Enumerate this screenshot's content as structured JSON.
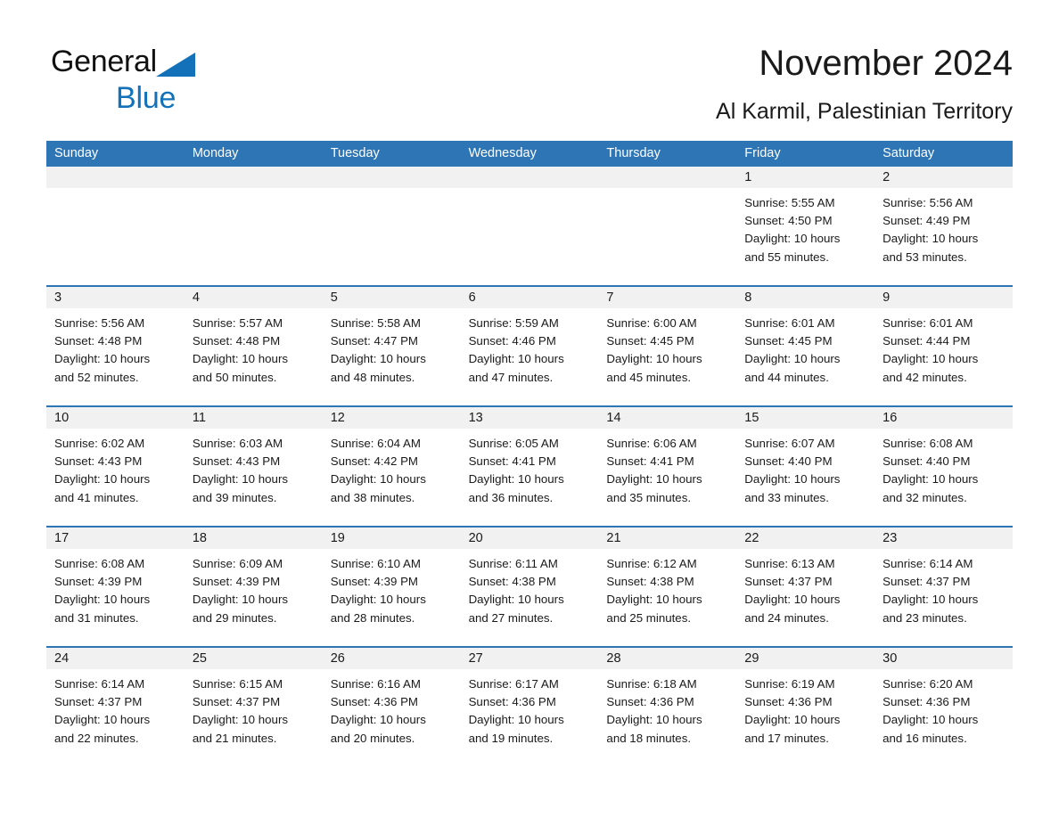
{
  "brand": {
    "word1": "General",
    "word2": "Blue",
    "accent_color": "#1271b8",
    "triangle_icon": "brand-triangle-icon"
  },
  "header": {
    "title": "November 2024",
    "subtitle": "Al Karmil, Palestinian Territory"
  },
  "theme": {
    "header_blue": "#2e75b6",
    "day_band_gray": "#f1f1f1",
    "text_color": "#1a1a1a"
  },
  "weekdays": [
    "Sunday",
    "Monday",
    "Tuesday",
    "Wednesday",
    "Thursday",
    "Friday",
    "Saturday"
  ],
  "weeks": [
    [
      {
        "empty": true
      },
      {
        "empty": true
      },
      {
        "empty": true
      },
      {
        "empty": true
      },
      {
        "empty": true
      },
      {
        "day": "1",
        "sunrise": "Sunrise: 5:55 AM",
        "sunset": "Sunset: 4:50 PM",
        "daylight1": "Daylight: 10 hours",
        "daylight2": "and 55 minutes."
      },
      {
        "day": "2",
        "sunrise": "Sunrise: 5:56 AM",
        "sunset": "Sunset: 4:49 PM",
        "daylight1": "Daylight: 10 hours",
        "daylight2": "and 53 minutes."
      }
    ],
    [
      {
        "day": "3",
        "sunrise": "Sunrise: 5:56 AM",
        "sunset": "Sunset: 4:48 PM",
        "daylight1": "Daylight: 10 hours",
        "daylight2": "and 52 minutes."
      },
      {
        "day": "4",
        "sunrise": "Sunrise: 5:57 AM",
        "sunset": "Sunset: 4:48 PM",
        "daylight1": "Daylight: 10 hours",
        "daylight2": "and 50 minutes."
      },
      {
        "day": "5",
        "sunrise": "Sunrise: 5:58 AM",
        "sunset": "Sunset: 4:47 PM",
        "daylight1": "Daylight: 10 hours",
        "daylight2": "and 48 minutes."
      },
      {
        "day": "6",
        "sunrise": "Sunrise: 5:59 AM",
        "sunset": "Sunset: 4:46 PM",
        "daylight1": "Daylight: 10 hours",
        "daylight2": "and 47 minutes."
      },
      {
        "day": "7",
        "sunrise": "Sunrise: 6:00 AM",
        "sunset": "Sunset: 4:45 PM",
        "daylight1": "Daylight: 10 hours",
        "daylight2": "and 45 minutes."
      },
      {
        "day": "8",
        "sunrise": "Sunrise: 6:01 AM",
        "sunset": "Sunset: 4:45 PM",
        "daylight1": "Daylight: 10 hours",
        "daylight2": "and 44 minutes."
      },
      {
        "day": "9",
        "sunrise": "Sunrise: 6:01 AM",
        "sunset": "Sunset: 4:44 PM",
        "daylight1": "Daylight: 10 hours",
        "daylight2": "and 42 minutes."
      }
    ],
    [
      {
        "day": "10",
        "sunrise": "Sunrise: 6:02 AM",
        "sunset": "Sunset: 4:43 PM",
        "daylight1": "Daylight: 10 hours",
        "daylight2": "and 41 minutes."
      },
      {
        "day": "11",
        "sunrise": "Sunrise: 6:03 AM",
        "sunset": "Sunset: 4:43 PM",
        "daylight1": "Daylight: 10 hours",
        "daylight2": "and 39 minutes."
      },
      {
        "day": "12",
        "sunrise": "Sunrise: 6:04 AM",
        "sunset": "Sunset: 4:42 PM",
        "daylight1": "Daylight: 10 hours",
        "daylight2": "and 38 minutes."
      },
      {
        "day": "13",
        "sunrise": "Sunrise: 6:05 AM",
        "sunset": "Sunset: 4:41 PM",
        "daylight1": "Daylight: 10 hours",
        "daylight2": "and 36 minutes."
      },
      {
        "day": "14",
        "sunrise": "Sunrise: 6:06 AM",
        "sunset": "Sunset: 4:41 PM",
        "daylight1": "Daylight: 10 hours",
        "daylight2": "and 35 minutes."
      },
      {
        "day": "15",
        "sunrise": "Sunrise: 6:07 AM",
        "sunset": "Sunset: 4:40 PM",
        "daylight1": "Daylight: 10 hours",
        "daylight2": "and 33 minutes."
      },
      {
        "day": "16",
        "sunrise": "Sunrise: 6:08 AM",
        "sunset": "Sunset: 4:40 PM",
        "daylight1": "Daylight: 10 hours",
        "daylight2": "and 32 minutes."
      }
    ],
    [
      {
        "day": "17",
        "sunrise": "Sunrise: 6:08 AM",
        "sunset": "Sunset: 4:39 PM",
        "daylight1": "Daylight: 10 hours",
        "daylight2": "and 31 minutes."
      },
      {
        "day": "18",
        "sunrise": "Sunrise: 6:09 AM",
        "sunset": "Sunset: 4:39 PM",
        "daylight1": "Daylight: 10 hours",
        "daylight2": "and 29 minutes."
      },
      {
        "day": "19",
        "sunrise": "Sunrise: 6:10 AM",
        "sunset": "Sunset: 4:39 PM",
        "daylight1": "Daylight: 10 hours",
        "daylight2": "and 28 minutes."
      },
      {
        "day": "20",
        "sunrise": "Sunrise: 6:11 AM",
        "sunset": "Sunset: 4:38 PM",
        "daylight1": "Daylight: 10 hours",
        "daylight2": "and 27 minutes."
      },
      {
        "day": "21",
        "sunrise": "Sunrise: 6:12 AM",
        "sunset": "Sunset: 4:38 PM",
        "daylight1": "Daylight: 10 hours",
        "daylight2": "and 25 minutes."
      },
      {
        "day": "22",
        "sunrise": "Sunrise: 6:13 AM",
        "sunset": "Sunset: 4:37 PM",
        "daylight1": "Daylight: 10 hours",
        "daylight2": "and 24 minutes."
      },
      {
        "day": "23",
        "sunrise": "Sunrise: 6:14 AM",
        "sunset": "Sunset: 4:37 PM",
        "daylight1": "Daylight: 10 hours",
        "daylight2": "and 23 minutes."
      }
    ],
    [
      {
        "day": "24",
        "sunrise": "Sunrise: 6:14 AM",
        "sunset": "Sunset: 4:37 PM",
        "daylight1": "Daylight: 10 hours",
        "daylight2": "and 22 minutes."
      },
      {
        "day": "25",
        "sunrise": "Sunrise: 6:15 AM",
        "sunset": "Sunset: 4:37 PM",
        "daylight1": "Daylight: 10 hours",
        "daylight2": "and 21 minutes."
      },
      {
        "day": "26",
        "sunrise": "Sunrise: 6:16 AM",
        "sunset": "Sunset: 4:36 PM",
        "daylight1": "Daylight: 10 hours",
        "daylight2": "and 20 minutes."
      },
      {
        "day": "27",
        "sunrise": "Sunrise: 6:17 AM",
        "sunset": "Sunset: 4:36 PM",
        "daylight1": "Daylight: 10 hours",
        "daylight2": "and 19 minutes."
      },
      {
        "day": "28",
        "sunrise": "Sunrise: 6:18 AM",
        "sunset": "Sunset: 4:36 PM",
        "daylight1": "Daylight: 10 hours",
        "daylight2": "and 18 minutes."
      },
      {
        "day": "29",
        "sunrise": "Sunrise: 6:19 AM",
        "sunset": "Sunset: 4:36 PM",
        "daylight1": "Daylight: 10 hours",
        "daylight2": "and 17 minutes."
      },
      {
        "day": "30",
        "sunrise": "Sunrise: 6:20 AM",
        "sunset": "Sunset: 4:36 PM",
        "daylight1": "Daylight: 10 hours",
        "daylight2": "and 16 minutes."
      }
    ]
  ]
}
